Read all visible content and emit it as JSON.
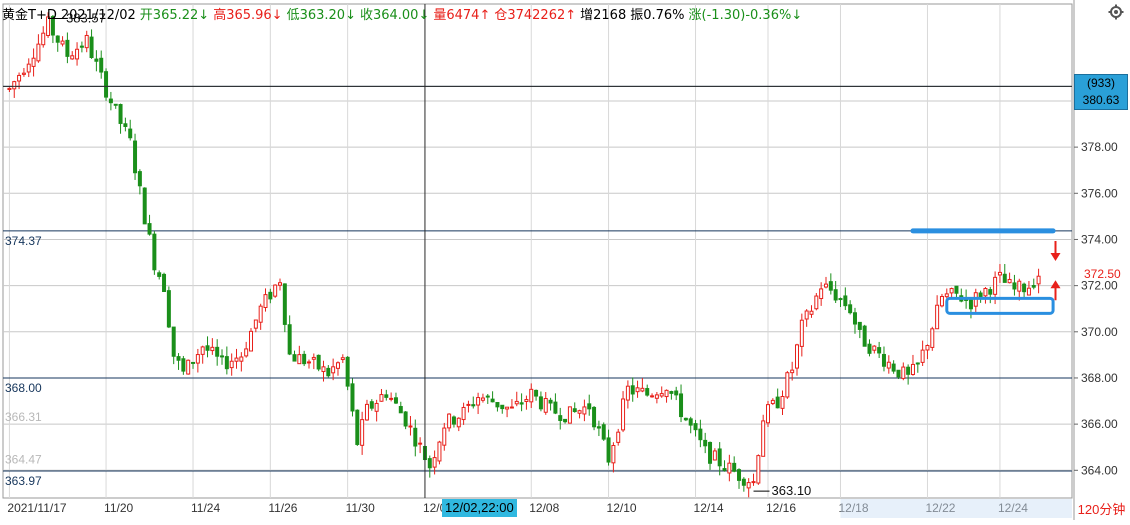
{
  "header": {
    "symbol": "黄金T+D",
    "date": "2021/12/02",
    "open_label": "开365.22↓",
    "high_label": "高365.96↓",
    "low_label": "低363.20↓",
    "close_label": "收364.00↓",
    "volume_label": "量6474↑",
    "oi_label": "仓3742262↑",
    "oi_change_label": "增2168",
    "amplitude_label": "振0.76%",
    "change_label": "涨(-1.30)-0.36%↓"
  },
  "crosshair": {
    "count_label": "(933)",
    "price_label": "380.63",
    "date_label": "12/02,22:00"
  },
  "timeframe_label": "120分钟",
  "colors": {
    "up": "#e8201a",
    "down": "#1a8f1a",
    "grid": "#c8c8c8",
    "hline": "#16365c",
    "accent": "#2aa0d8"
  },
  "icons": {
    "settings": "gear-icon"
  },
  "chart_data": {
    "type": "candlestick",
    "title": "",
    "xlabel": "",
    "ylabel": "",
    "ylim": [
      362.8,
      384.2
    ],
    "grid": true,
    "y_ticks": [
      364,
      366,
      368,
      370,
      372,
      374,
      376,
      378,
      380
    ],
    "y_tick_labels": [
      "364.00",
      "366.00",
      "368.00",
      "370.00",
      "372.00",
      "374.00",
      "376.00",
      "378.00",
      "380.00"
    ],
    "x_ticks": [
      "2021/11/17",
      "11/20",
      "11/24",
      "11/26",
      "11/30",
      "12/02",
      "12/08",
      "12/10",
      "12/14",
      "12/16",
      "12/18",
      "12/22",
      "12/24"
    ],
    "x_tick_index": [
      0,
      20,
      38,
      54,
      70,
      86,
      108,
      124,
      142,
      157,
      172,
      190,
      205
    ],
    "total_bars": 220,
    "horizontal_levels": [
      {
        "value": 380.63,
        "label": ""
      },
      {
        "value": 374.37,
        "label": "374.37"
      },
      {
        "value": 368.0,
        "label": "368.00"
      },
      {
        "value": 363.97,
        "label": "363.97"
      }
    ],
    "faint_levels": [
      {
        "value": 366.31,
        "label": "366.31"
      },
      {
        "value": 364.47,
        "label": "364.47"
      }
    ],
    "annotations": [
      {
        "label": "383.57",
        "value": 383.57,
        "bar_index": 8
      },
      {
        "label": "363.10",
        "value": 363.1,
        "bar_index": 154
      },
      {
        "label": "372.50",
        "value": 372.5,
        "bar_index": 212
      }
    ],
    "crosshair_index": 86,
    "keypoints": [
      [
        0,
        380.5
      ],
      [
        3,
        381.5
      ],
      [
        6,
        382.5
      ],
      [
        8,
        383.3
      ],
      [
        12,
        382.0
      ],
      [
        16,
        382.6
      ],
      [
        19,
        381.0
      ],
      [
        22,
        379.5
      ],
      [
        25,
        378.2
      ],
      [
        28,
        375.0
      ],
      [
        30,
        373.0
      ],
      [
        32,
        372.0
      ],
      [
        34,
        369.0
      ],
      [
        36,
        368.2
      ],
      [
        40,
        369.4
      ],
      [
        44,
        368.6
      ],
      [
        48,
        369.0
      ],
      [
        52,
        371.0
      ],
      [
        56,
        372.3
      ],
      [
        58,
        369.0
      ],
      [
        62,
        368.7
      ],
      [
        66,
        368.2
      ],
      [
        69,
        368.8
      ],
      [
        72,
        365.2
      ],
      [
        74,
        366.6
      ],
      [
        78,
        367.4
      ],
      [
        82,
        366.2
      ],
      [
        85,
        365.0
      ],
      [
        87,
        364.2
      ],
      [
        90,
        366.0
      ],
      [
        94,
        366.5
      ],
      [
        97,
        367.2
      ],
      [
        100,
        367.0
      ],
      [
        104,
        366.6
      ],
      [
        108,
        367.3
      ],
      [
        112,
        366.6
      ],
      [
        116,
        366.4
      ],
      [
        120,
        366.8
      ],
      [
        124,
        364.5
      ],
      [
        128,
        367.5
      ],
      [
        132,
        367.3
      ],
      [
        136,
        367.7
      ],
      [
        140,
        366.2
      ],
      [
        144,
        364.8
      ],
      [
        148,
        364.2
      ],
      [
        151,
        363.8
      ],
      [
        154,
        363.5
      ],
      [
        156,
        366.3
      ],
      [
        159,
        367.0
      ],
      [
        162,
        368.4
      ],
      [
        164,
        370.2
      ],
      [
        166,
        371.0
      ],
      [
        168,
        372.0
      ],
      [
        170,
        371.8
      ],
      [
        174,
        371.0
      ],
      [
        176,
        369.8
      ],
      [
        180,
        369.0
      ],
      [
        184,
        368.3
      ],
      [
        186,
        368.0
      ],
      [
        188,
        368.5
      ],
      [
        190,
        369.6
      ],
      [
        193,
        371.5
      ],
      [
        196,
        371.6
      ],
      [
        199,
        371.3
      ],
      [
        202,
        371.8
      ],
      [
        205,
        372.3
      ],
      [
        208,
        371.8
      ],
      [
        211,
        372.0
      ],
      [
        213,
        372.5
      ]
    ]
  }
}
